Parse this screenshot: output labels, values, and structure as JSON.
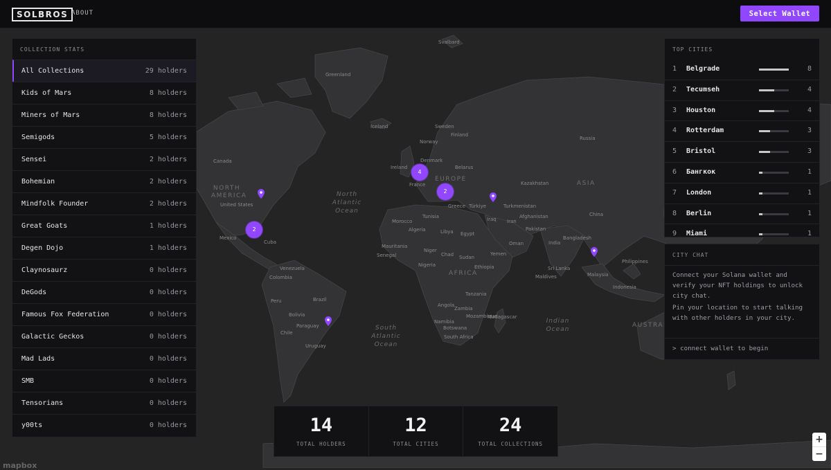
{
  "header": {
    "logo": "SOLBROS",
    "nav_about": "ABOUT",
    "wallet_button": "Select Wallet"
  },
  "collection_stats": {
    "title": "COLLECTION STATS",
    "items": [
      {
        "name": "All Collections",
        "count": "29 holders",
        "active": true
      },
      {
        "name": "Kids of Mars",
        "count": "8 holders"
      },
      {
        "name": "Miners of Mars",
        "count": "8 holders"
      },
      {
        "name": "Semigods",
        "count": "5 holders"
      },
      {
        "name": "Sensei",
        "count": "2 holders"
      },
      {
        "name": "Bohemian",
        "count": "2 holders"
      },
      {
        "name": "Mindfolk Founder",
        "count": "2 holders"
      },
      {
        "name": "Great Goats",
        "count": "1 holders"
      },
      {
        "name": "Degen Dojo",
        "count": "1 holders"
      },
      {
        "name": "Claynosaurz",
        "count": "0 holders"
      },
      {
        "name": "DeGods",
        "count": "0 holders"
      },
      {
        "name": "Famous Fox Federation",
        "count": "0 holders"
      },
      {
        "name": "Galactic Geckos",
        "count": "0 holders"
      },
      {
        "name": "Mad Lads",
        "count": "0 holders"
      },
      {
        "name": "SMB",
        "count": "0 holders"
      },
      {
        "name": "Tensorians",
        "count": "0 holders"
      },
      {
        "name": "y00ts",
        "count": "0 holders"
      }
    ]
  },
  "top_cities": {
    "title": "TOP CITIES",
    "max_count": 8,
    "items": [
      {
        "rank": "1",
        "name": "Belgrade",
        "count": "8"
      },
      {
        "rank": "2",
        "name": "Tecumseh",
        "count": "4"
      },
      {
        "rank": "3",
        "name": "Houston",
        "count": "4"
      },
      {
        "rank": "4",
        "name": "Rotterdam",
        "count": "3"
      },
      {
        "rank": "5",
        "name": "Bristol",
        "count": "3"
      },
      {
        "rank": "6",
        "name": "Бангкок",
        "count": "1"
      },
      {
        "rank": "7",
        "name": "London",
        "count": "1"
      },
      {
        "rank": "8",
        "name": "Berlin",
        "count": "1"
      },
      {
        "rank": "9",
        "name": "Miami",
        "count": "1"
      }
    ]
  },
  "city_chat": {
    "title": "CITY CHAT",
    "line1": "Connect your Solana wallet and verify your NFT holdings to unlock city chat.",
    "line2": "Pin your location to start talking with other holders in your city.",
    "footer": "> connect wallet to begin"
  },
  "totals": [
    {
      "value": "14",
      "label": "TOTAL HOLDERS"
    },
    {
      "value": "12",
      "label": "TOTAL CITIES"
    },
    {
      "value": "24",
      "label": "TOTAL COLLECTIONS"
    }
  ],
  "map": {
    "clusters": [
      "4",
      "2",
      "2"
    ],
    "labels": {
      "svalbard": "Svalbard",
      "greenland": "Greenland",
      "iceland": "Iceland",
      "sweden": "Sweden",
      "norway": "Norway",
      "finland": "Finland",
      "russia": "Russia",
      "canada": "Canada",
      "north_america": "NORTH AMERICA",
      "united_states": "United States",
      "mexico": "Mexico",
      "cuba": "Cuba",
      "ireland": "Ireland",
      "denmark": "Denmark",
      "belarus": "Belarus",
      "europe": "EUROPE",
      "france": "France",
      "kazakhstan": "Kazakhstan",
      "asia": "ASIA",
      "north_atlantic": "North Atlantic Ocean",
      "greece": "Greece",
      "turkiye": "Türkiye",
      "turkmenistan": "Turkmenistan",
      "morocco": "Morocco",
      "tunisia": "Tunisia",
      "algeria": "Algeria",
      "libya": "Libya",
      "egypt": "Egypt",
      "iraq": "Iraq",
      "iran": "Iran",
      "afghanistan": "Afghanistan",
      "pakistan": "Pakistan",
      "china": "China",
      "mauritania": "Mauritania",
      "senegal": "Senegal",
      "niger": "Niger",
      "chad": "Chad",
      "sudan": "Sudan",
      "yemen": "Yemen",
      "oman": "Oman",
      "india": "India",
      "bangladesh": "Bangladesh",
      "nigeria": "Nigeria",
      "ethiopia": "Ethiopia",
      "africa": "AFRICA",
      "sri_lanka": "Sri Lanka",
      "maldives": "Maldives",
      "philippines": "Philippines",
      "malaysia": "Malaysia",
      "indonesia": "Indonesia",
      "venezuela": "Venezuela",
      "colombia": "Colombia",
      "peru": "Peru",
      "brazil": "Brazil",
      "bolivia": "Bolivia",
      "paraguay": "Paraguay",
      "chile": "Chile",
      "uruguay": "Uruguay",
      "tanzania": "Tanzania",
      "angola": "Angola",
      "zambia": "Zambia",
      "namibia": "Namibia",
      "mozambique": "Mozambique",
      "botswana": "Botswana",
      "south_africa": "South Africa",
      "madagascar": "Madagascar",
      "south_atlantic": "South Atlantic Ocean",
      "indian_ocean": "Indian Ocean",
      "australia": "AUSTRALIA"
    },
    "attribution": "mapbox"
  }
}
